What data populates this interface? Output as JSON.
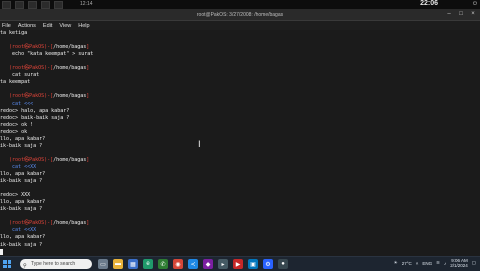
{
  "host_bar": {
    "clock": "12:14",
    "time": "22:06"
  },
  "window": {
    "title": "root@PakOS: 3/27/2008: /home/bagas"
  },
  "menu": [
    "File",
    "Actions",
    "Edit",
    "View",
    "Help"
  ],
  "terminal": {
    "lines": [
      {
        "segments": [
          {
            "t": "ta ketiga",
            "c": "white"
          }
        ]
      },
      {
        "segments": []
      },
      {
        "segments": [
          {
            "t": "   (root㉿PakOS)-[",
            "c": "red"
          },
          {
            "t": "/home/bagas",
            "c": "white"
          },
          {
            "t": "]",
            "c": "red"
          }
        ]
      },
      {
        "segments": [
          {
            "t": "    echo \"kata keempat\" > surat",
            "c": "white"
          }
        ]
      },
      {
        "segments": []
      },
      {
        "segments": [
          {
            "t": "   (root㉿PakOS)-[",
            "c": "red"
          },
          {
            "t": "/home/bagas",
            "c": "white"
          },
          {
            "t": "]",
            "c": "red"
          }
        ]
      },
      {
        "segments": [
          {
            "t": "    cat surat",
            "c": "white"
          }
        ]
      },
      {
        "segments": [
          {
            "t": "ta keempat",
            "c": "white"
          }
        ]
      },
      {
        "segments": []
      },
      {
        "segments": [
          {
            "t": "   (root㉿PakOS)-[",
            "c": "red"
          },
          {
            "t": "/home/bagas",
            "c": "white"
          },
          {
            "t": "]",
            "c": "red"
          }
        ]
      },
      {
        "segments": [
          {
            "t": "    cat <<<",
            "c": "blue"
          }
        ]
      },
      {
        "segments": [
          {
            "t": "redoc> halo, apa kabar?",
            "c": "white"
          }
        ]
      },
      {
        "segments": [
          {
            "t": "redoc> baik-baik saja ?",
            "c": "white"
          }
        ]
      },
      {
        "segments": [
          {
            "t": "redoc> ok !",
            "c": "white"
          }
        ]
      },
      {
        "segments": [
          {
            "t": "redoc> ok",
            "c": "white"
          }
        ]
      },
      {
        "segments": [
          {
            "t": "llo, apa kabar?",
            "c": "white"
          }
        ]
      },
      {
        "segments": [
          {
            "t": "ik-baik saja ?",
            "c": "white"
          }
        ]
      },
      {
        "segments": []
      },
      {
        "segments": [
          {
            "t": "   (root㉿PakOS)-[",
            "c": "red"
          },
          {
            "t": "/home/bagas",
            "c": "white"
          },
          {
            "t": "]",
            "c": "red"
          }
        ]
      },
      {
        "segments": [
          {
            "t": "    cat <<XX",
            "c": "blue"
          }
        ]
      },
      {
        "segments": [
          {
            "t": "llo, apa kabar?",
            "c": "white"
          }
        ]
      },
      {
        "segments": [
          {
            "t": "ik-baik saja ?",
            "c": "white"
          }
        ]
      },
      {
        "segments": []
      },
      {
        "segments": [
          {
            "t": "redoc> XXX",
            "c": "white"
          }
        ]
      },
      {
        "segments": [
          {
            "t": "llo, apa kabar?",
            "c": "white"
          }
        ]
      },
      {
        "segments": [
          {
            "t": "ik-baik saja ?",
            "c": "white"
          }
        ]
      },
      {
        "segments": []
      },
      {
        "segments": [
          {
            "t": "   (root㉿PakOS)-[",
            "c": "red"
          },
          {
            "t": "/home/bagas",
            "c": "white"
          },
          {
            "t": "]",
            "c": "red"
          }
        ]
      },
      {
        "segments": [
          {
            "t": "    cat <<XX",
            "c": "blue"
          }
        ]
      },
      {
        "segments": [
          {
            "t": "llo, apa kabar?",
            "c": "white"
          }
        ]
      },
      {
        "segments": [
          {
            "t": "ik-baik saja ?",
            "c": "white"
          }
        ]
      }
    ]
  },
  "taskbar": {
    "search_placeholder": "Type here to search",
    "tray_temp": "27°C",
    "tray_lang": "ENG",
    "tray_time": "9:06 AM",
    "tray_date": "2/1/2024"
  },
  "colors": {
    "prompt_red": "#e3453a",
    "command_blue": "#5a8cf0",
    "taskbar": "#1d2530"
  }
}
